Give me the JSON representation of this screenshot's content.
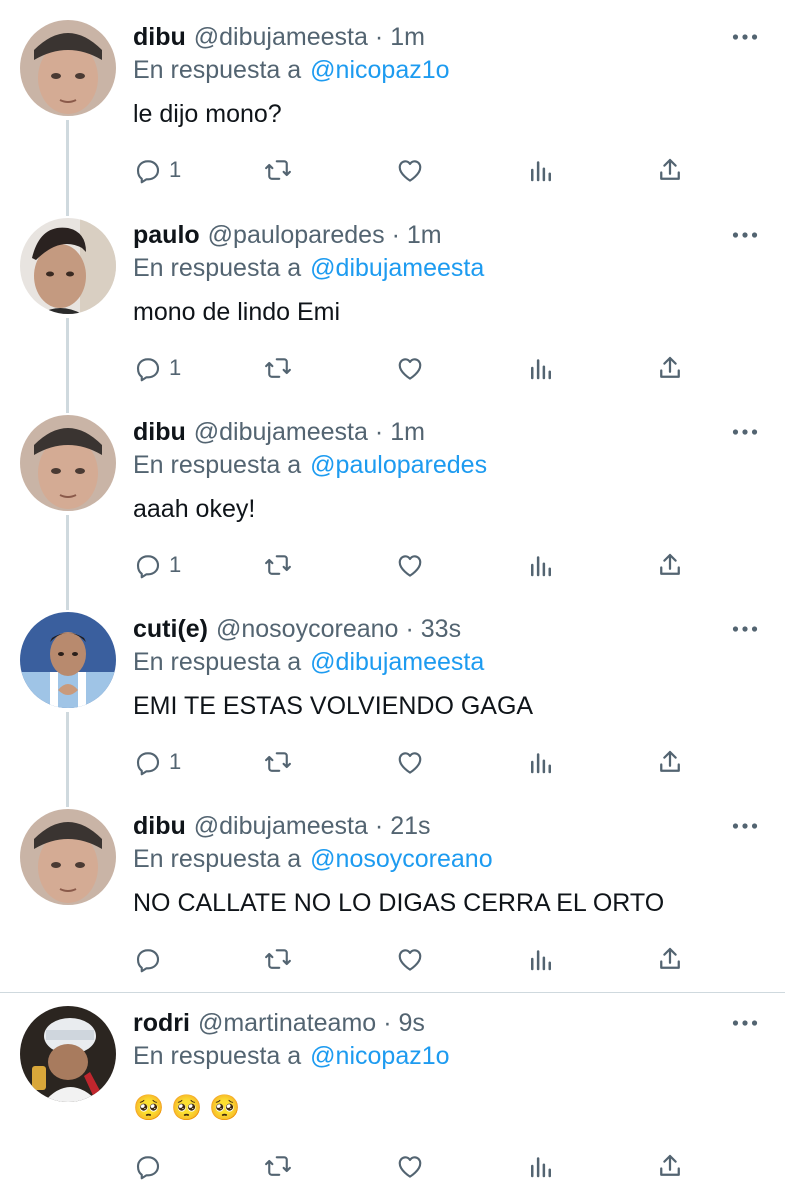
{
  "colors": {
    "name": "#0f1419",
    "meta": "#536471",
    "mention": "#1d9bf0",
    "thread_line": "#cfd9de",
    "icon": "#536471"
  },
  "icons": {
    "more": "more-dots-icon",
    "reply": "reply-bubble-icon",
    "retweet": "retweet-icon",
    "like": "heart-icon",
    "views": "views-bars-icon",
    "share": "share-upload-icon"
  },
  "reply_prefix": "En respuesta a",
  "tweets": [
    {
      "name": "dibu",
      "handle": "@dibujameesta",
      "time": "1m",
      "reply_to": "@nicopaz1o",
      "text": "le dijo mono?",
      "reply_count": "1"
    },
    {
      "name": "paulo",
      "handle": "@pauloparedes",
      "time": "1m",
      "reply_to": "@dibujameesta",
      "text": "mono de lindo Emi",
      "reply_count": "1"
    },
    {
      "name": "dibu",
      "handle": "@dibujameesta",
      "time": "1m",
      "reply_to": "@pauloparedes",
      "text": "aaah okey!",
      "reply_count": "1"
    },
    {
      "name": "cuti(e)",
      "handle": "@nosoycoreano",
      "time": "33s",
      "reply_to": "@dibujameesta",
      "text": "EMI TE ESTAS VOLVIENDO GAGA",
      "reply_count": "1"
    },
    {
      "name": "dibu",
      "handle": "@dibujameesta",
      "time": "21s",
      "reply_to": "@nosoycoreano",
      "text": "NO CALLATE NO LO DIGAS CERRA EL ORTO",
      "reply_count": ""
    },
    {
      "name": "rodri",
      "handle": "@martinateamo",
      "time": "9s",
      "reply_to": "@nicopaz1o",
      "text": "🥺 🥺 🥺",
      "reply_count": ""
    }
  ]
}
